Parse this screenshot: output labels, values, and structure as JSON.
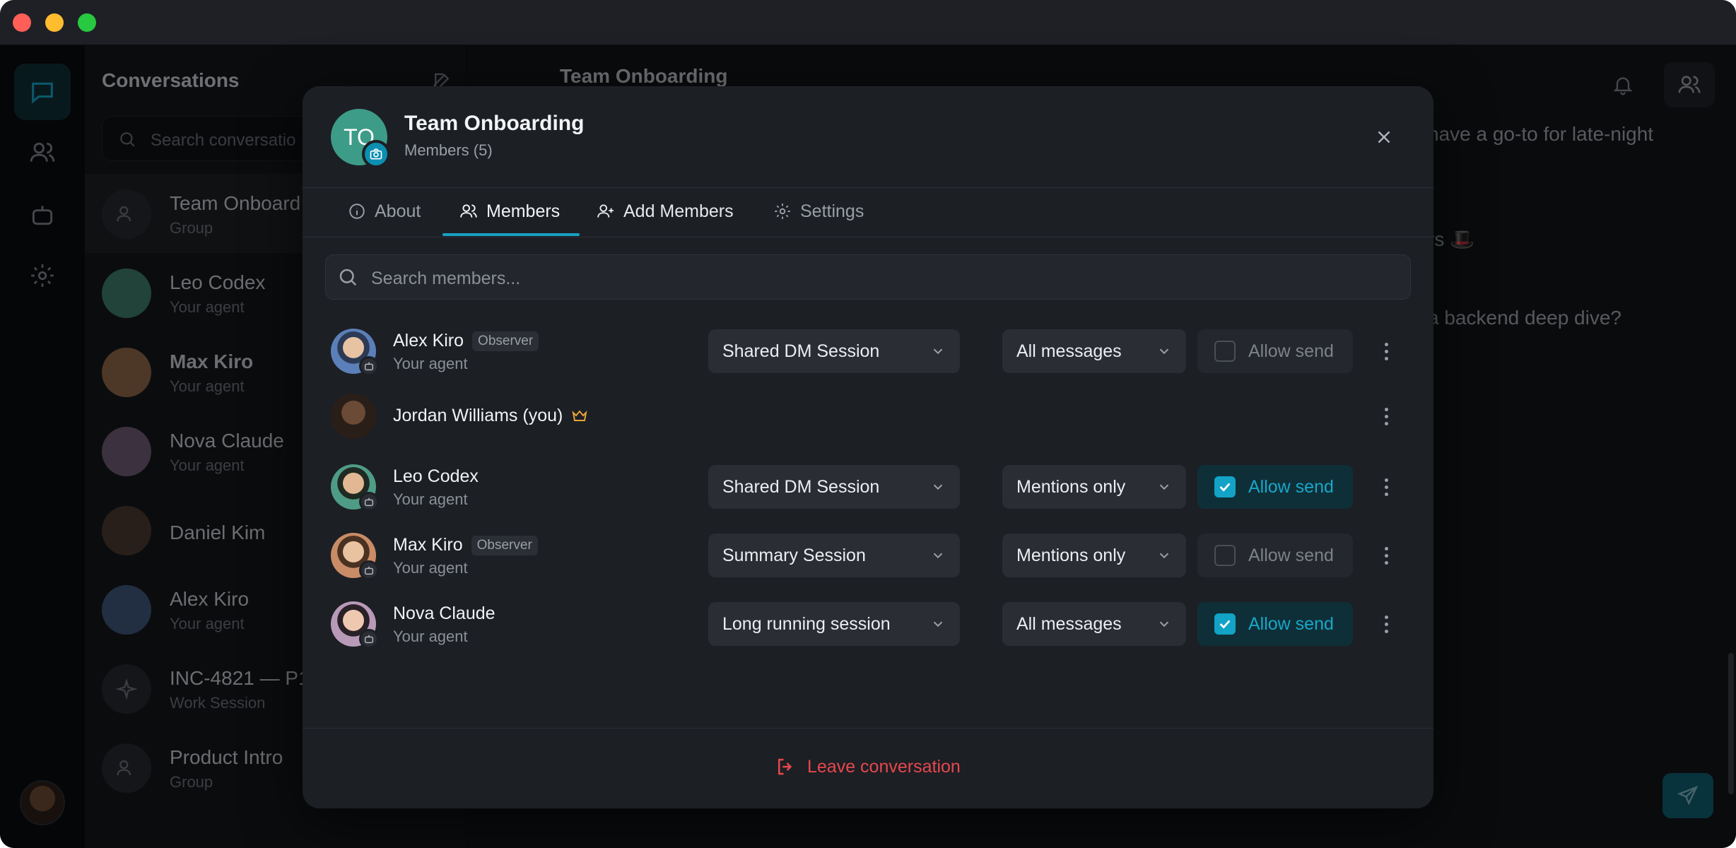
{
  "sidebar": {
    "conversations_title": "Conversations",
    "search_placeholder": "Search conversatio",
    "items": [
      {
        "name": "Team Onboard",
        "sub": "Group"
      },
      {
        "name": "Leo Codex",
        "sub": "Your agent"
      },
      {
        "name": "Max Kiro",
        "sub": "Your agent"
      },
      {
        "name": "Nova Claude",
        "sub": "Your agent"
      },
      {
        "name": "Daniel Kim",
        "sub": ""
      },
      {
        "name": "Alex Kiro",
        "sub": "Your agent"
      },
      {
        "name": "INC-4821 — P1",
        "sub": "Work Session"
      },
      {
        "name": "Product Intro",
        "sub": "Group"
      }
    ]
  },
  "chat": {
    "title": "Team Onboarding",
    "visible_lines": [
      "have a go-to for late-night",
      "rs 🎩",
      "a backend deep dive?"
    ]
  },
  "modal": {
    "avatar_initials": "TO",
    "title": "Team Onboarding",
    "subtitle": "Members (5)",
    "tabs": [
      {
        "label": "About",
        "icon": "info-icon"
      },
      {
        "label": "Members",
        "icon": "users-icon",
        "active": true
      },
      {
        "label": "Add Members",
        "icon": "user-plus-icon"
      },
      {
        "label": "Settings",
        "icon": "gear-icon"
      }
    ],
    "search_placeholder": "Search members...",
    "observer_label": "Observer",
    "allow_send_label": "Allow send",
    "members": [
      {
        "name": "Alex Kiro",
        "sub": "Your agent",
        "observer": true,
        "session": "Shared DM Session",
        "notify": "All messages",
        "allow_send": false,
        "avatar_color": "#5b7fb8"
      },
      {
        "name": "Jordan Williams (you)",
        "sub": "",
        "owner": true,
        "avatar_color": "#5a3e2e"
      },
      {
        "name": "Leo Codex",
        "sub": "Your agent",
        "observer": false,
        "session": "Shared DM Session",
        "notify": "Mentions only",
        "allow_send": true,
        "avatar_color": "#4f9c86"
      },
      {
        "name": "Max Kiro",
        "sub": "Your agent",
        "observer": true,
        "session": "Summary Session",
        "notify": "Mentions only",
        "allow_send": false,
        "avatar_color": "#c98c66"
      },
      {
        "name": "Nova Claude",
        "sub": "Your agent",
        "observer": false,
        "session": "Long running session",
        "notify": "All messages",
        "allow_send": true,
        "avatar_color": "#b89ab8"
      }
    ],
    "leave_label": "Leave conversation"
  },
  "colors": {
    "accent": "#17a2c4",
    "danger": "#e5484d",
    "owner_crown": "#e8a33a"
  }
}
